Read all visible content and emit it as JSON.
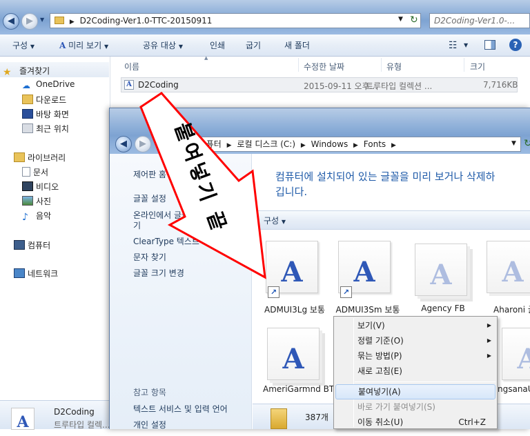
{
  "back_window": {
    "address": "D2Coding-Ver1.0-TTC-20150911",
    "search_placeholder": "D2Coding-Ver1.0-...",
    "toolbar": {
      "organize": "구성",
      "preview": "미리 보기",
      "share": "공유 대상",
      "print": "인쇄",
      "burn": "굽기",
      "new_folder": "새 폴더"
    },
    "nav": {
      "favorites": "즐겨찾기",
      "onedrive": "OneDrive",
      "downloads": "다운로드",
      "desktop": "바탕 화면",
      "recent": "최근 위치",
      "libraries": "라이브러리",
      "documents": "문서",
      "videos": "비디오",
      "pictures": "사진",
      "music": "음악",
      "computer": "컴퓨터",
      "network": "네트워크"
    },
    "columns": {
      "name": "이름",
      "modified": "수정한 날짜",
      "type": "유형",
      "size": "크기"
    },
    "files": [
      {
        "name": "D2Coding",
        "modified": "2015-09-11 오후...",
        "type": "트루타입 컬렉션 ...",
        "size": "7,716KB"
      }
    ],
    "details": {
      "name": "D2Coding",
      "type": "트루타입 컬렉..."
    }
  },
  "front_window": {
    "breadcrumb": {
      "part1": "퓨터",
      "part2": "로컬 디스크 (C:)",
      "part3": "Windows",
      "part4": "Fonts"
    },
    "sidebar": {
      "home": "제어판 홈",
      "font_settings": "글꼴 설정",
      "online": "온라인에서 글꼴 정보 얻",
      "online_cont": "기",
      "cleartype": "ClearType 텍스트 조정",
      "find_char": "문자 찾기",
      "change_size": "글꼴 크기 변경",
      "see_also": "참고 항목",
      "text_services": "텍스트 서비스 및 입력 언어",
      "personalize": "개인 설정"
    },
    "description_1": "컴퓨터에 설치되어 있는 글꼴을 미리 보거나 삭제하",
    "description_2": "깁니다.",
    "organize": "구성",
    "fonts": [
      "ADMUI3Lg 보통",
      "ADMUI3Sm 보통",
      "Agency FB",
      "Aharoni 굵",
      "AmeriGarmnd BT",
      "ngsanaU"
    ],
    "status_count": "387개"
  },
  "context_menu": {
    "items": [
      {
        "label": "보기(V)",
        "submenu": true
      },
      {
        "label": "정렬 기준(O)",
        "submenu": true
      },
      {
        "label": "묶는 방법(P)",
        "submenu": true
      },
      {
        "label": "새로 고침(E)"
      },
      {
        "label": "붙여넣기(A)"
      },
      {
        "label": "바로 가기 붙여넣기(S)"
      },
      {
        "label": "이동 취소(U)",
        "shortcut": "Ctrl+Z"
      }
    ]
  },
  "annotation": {
    "text": "붙여넣기 끝",
    "color": "#ff0000"
  }
}
